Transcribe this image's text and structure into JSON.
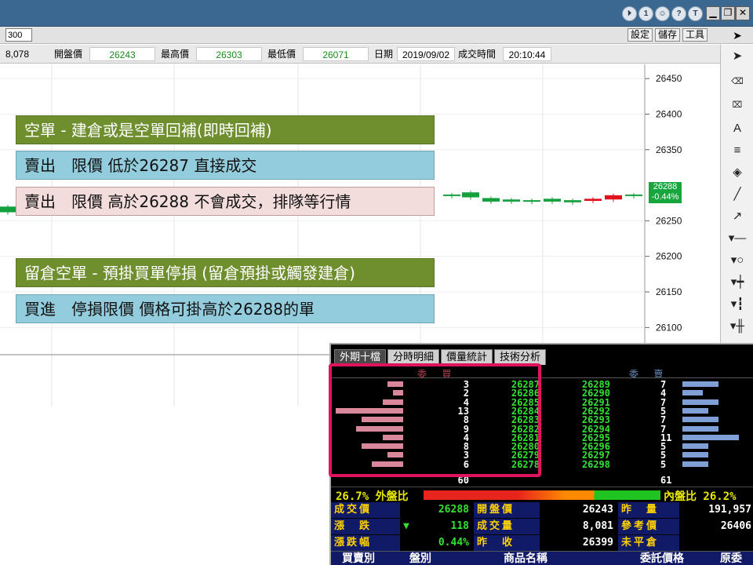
{
  "titlebar": {
    "round_buttons": [
      "⏵",
      "1",
      "☺",
      "?",
      "T"
    ],
    "window_buttons": [
      "▁",
      "❐",
      "✕"
    ]
  },
  "toolbar": {
    "qty_value": "300",
    "settings_label": "設定",
    "save_label": "儲存",
    "tools_label": "工具"
  },
  "quote": {
    "volume": "8,078",
    "open_label": "開盤價",
    "open_value": "26243",
    "high_label": "最高價",
    "high_value": "26303",
    "low_label": "最低價",
    "low_value": "26071",
    "date_label": "日期",
    "date_value": "2019/09/02",
    "time_label": "成交時間",
    "time_value": "20:10:44"
  },
  "chart_data": {
    "type": "candlestick",
    "y_ticks": [
      "26450",
      "26400",
      "26350",
      "26250",
      "26200",
      "26150",
      "26100"
    ],
    "ylim": [
      26075,
      26470
    ],
    "last_price": "26288",
    "last_change": "-0.44%",
    "candles": [
      {
        "open": 26270,
        "close": 26262
      },
      {
        "open": 26287,
        "close": 26285
      },
      {
        "open": 26290,
        "close": 26283
      },
      {
        "open": 26282,
        "close": 26277
      },
      {
        "open": 26280,
        "close": 26277
      },
      {
        "open": 26279,
        "close": 26277
      },
      {
        "open": 26281,
        "close": 26277
      },
      {
        "open": 26279,
        "close": 26276
      },
      {
        "open": 26278,
        "close": 26281
      },
      {
        "open": 26280,
        "close": 26286
      },
      {
        "open": 26287,
        "close": 26287
      }
    ]
  },
  "notes": [
    "空單 - 建倉或是空單回補(即時回補)",
    "賣出　限價 低於26287 直接成交",
    "賣出　限價 高於26288 不會成交，排隊等行情",
    "留倉空單 - 預掛買單停損 (留倉預掛或觸發建倉)",
    "買進　停損限價 價格可掛高於26288的單"
  ],
  "panel": {
    "tabs": [
      "外期十檔",
      "分時明細",
      "價量統計",
      "技術分析"
    ],
    "bid_header": "委 買",
    "ask_header": "委 賣",
    "bids": [
      {
        "qty": "3",
        "price": "26287"
      },
      {
        "qty": "2",
        "price": "26286"
      },
      {
        "qty": "4",
        "price": "26285"
      },
      {
        "qty": "13",
        "price": "26284"
      },
      {
        "qty": "8",
        "price": "26283"
      },
      {
        "qty": "9",
        "price": "26282"
      },
      {
        "qty": "4",
        "price": "26281"
      },
      {
        "qty": "8",
        "price": "26280"
      },
      {
        "qty": "3",
        "price": "26279"
      },
      {
        "qty": "6",
        "price": "26278"
      }
    ],
    "asks": [
      {
        "qty": "7",
        "price": "26289"
      },
      {
        "qty": "4",
        "price": "26290"
      },
      {
        "qty": "7",
        "price": "26291"
      },
      {
        "qty": "5",
        "price": "26292"
      },
      {
        "qty": "7",
        "price": "26293"
      },
      {
        "qty": "7",
        "price": "26294"
      },
      {
        "qty": "11",
        "price": "26295"
      },
      {
        "qty": "5",
        "price": "26296"
      },
      {
        "qty": "5",
        "price": "26297"
      },
      {
        "qty": "5",
        "price": "26298"
      }
    ],
    "bid_total": "60",
    "ask_total": "61",
    "outer_ratio": "26.7% 外盤比",
    "inner_ratio": "內盤比 26.2%",
    "stats": {
      "last_label": "成交價",
      "last_value": "26288",
      "open_label": "開盤價",
      "open_value": "26243",
      "prevvol_label": "昨　量",
      "prevvol_value": "191,957",
      "change_label": "漲　跌",
      "change_arrow": "▼",
      "change_value": "118",
      "volume_label": "成交量",
      "volume_value": "8,081",
      "ref_label": "參考價",
      "ref_value": "26406",
      "pct_label": "漲跌幅",
      "pct_value": "0.44%",
      "prevclose_label": "昨　收",
      "prevclose_value": "26399",
      "open_int_label": "未平倉",
      "open_int_value": ""
    },
    "order_headers": [
      "買賣別",
      "盤別",
      "商品名稱",
      "委託價格",
      "原委"
    ]
  },
  "colors": {
    "up": "#e0141e",
    "down": "#14a03c",
    "highlight": "#e0145e"
  }
}
